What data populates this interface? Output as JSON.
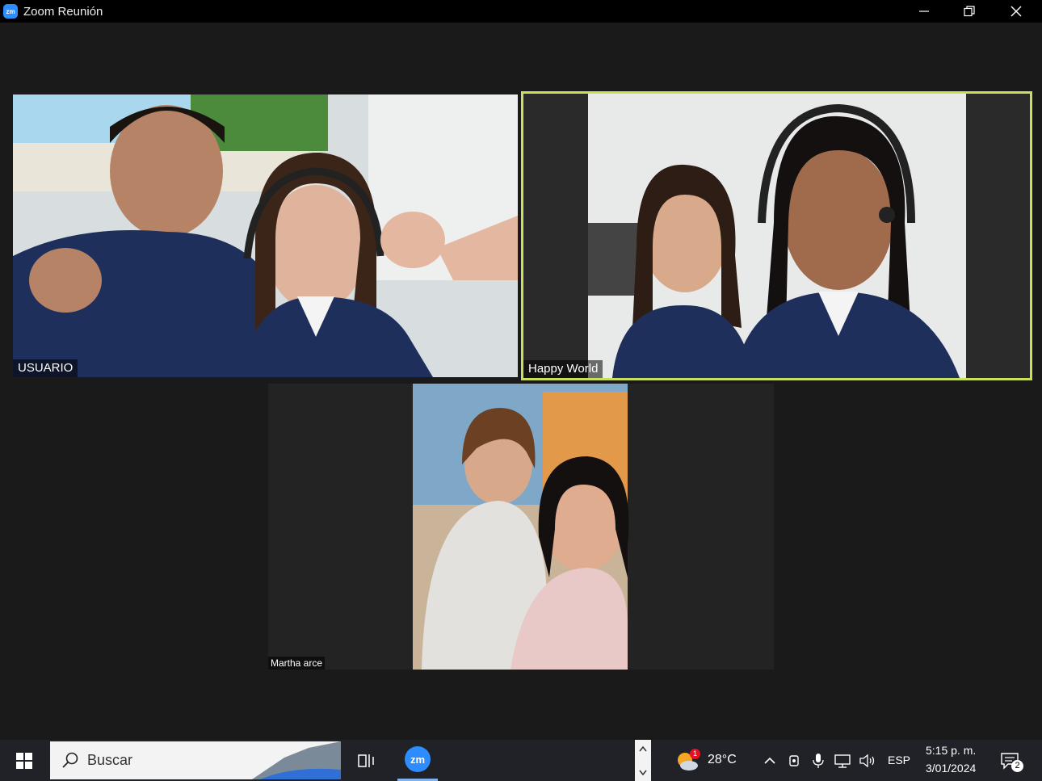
{
  "window": {
    "title": "Zoom Reunión",
    "app_icon_label": "zm"
  },
  "participants": [
    {
      "name": "USUARIO",
      "active_speaker": false
    },
    {
      "name": "Happy World",
      "active_speaker": true
    },
    {
      "name": "Martha arce",
      "active_speaker": false
    }
  ],
  "taskbar": {
    "search_placeholder": "Buscar",
    "zoom_app_label": "zm",
    "weather_temp": "28°C",
    "weather_badge": "1",
    "language": "ESP",
    "time": "5:15 p. m.",
    "date": "3/01/2024",
    "notification_count": "2"
  },
  "colors": {
    "active_speaker_border": "#c8e05b",
    "zoom_blue": "#2d8cff",
    "background": "#1a1a1a"
  }
}
